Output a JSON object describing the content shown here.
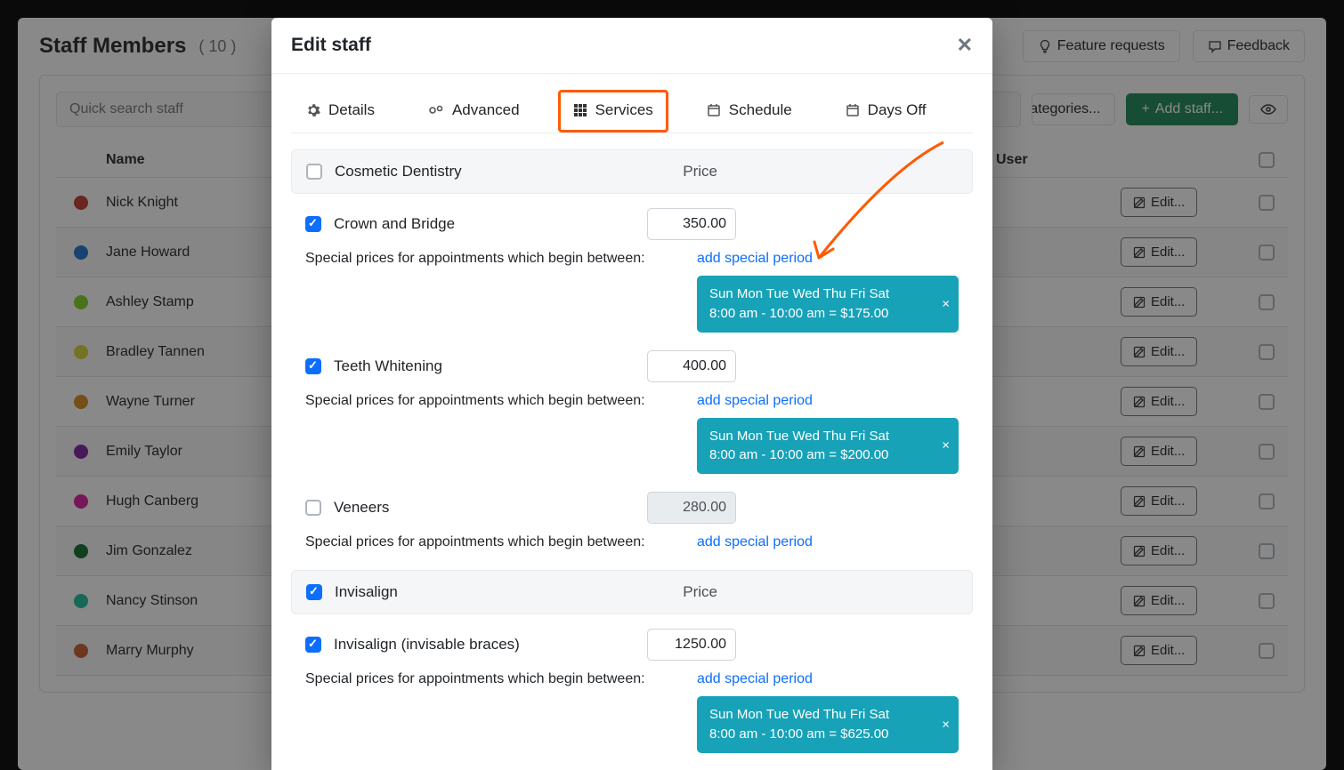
{
  "page": {
    "title": "Staff Members",
    "count": "( 10 )",
    "search_placeholder": "Quick search staff",
    "feature_button": "Feature requests",
    "feedback_button": "Feedback",
    "categories_button": "Categories...",
    "add_staff_button": "Add staff...",
    "col_name": "Name",
    "col_user": "User",
    "edit_label": "Edit..."
  },
  "staff": [
    {
      "name": "Nick Knight",
      "color": "#c0392b"
    },
    {
      "name": "Jane Howard",
      "color": "#1e70cd"
    },
    {
      "name": "Ashley Stamp",
      "color": "#7ed321"
    },
    {
      "name": "Bradley Tannen",
      "color": "#d6d034"
    },
    {
      "name": "Wayne Turner",
      "color": "#d68a1f"
    },
    {
      "name": "Emily Taylor",
      "color": "#7b1fa2"
    },
    {
      "name": "Hugh Canberg",
      "color": "#d81b9a"
    },
    {
      "name": "Jim Gonzalez",
      "color": "#116b29"
    },
    {
      "name": "Nancy Stinson",
      "color": "#1abc9c"
    },
    {
      "name": "Marry Murphy",
      "color": "#c75b2c"
    }
  ],
  "modal": {
    "title": "Edit staff",
    "tabs": {
      "details": "Details",
      "advanced": "Advanced",
      "services": "Services",
      "schedule": "Schedule",
      "daysoff": "Days Off"
    },
    "special_label": "Special prices for appointments which begin between:",
    "add_period": "add special period",
    "price_header": "Price",
    "categories": [
      {
        "name": "Cosmetic Dentistry",
        "checked": false,
        "services": [
          {
            "name": "Crown and Bridge",
            "checked": true,
            "price": "350.00",
            "period": {
              "days": "Sun Mon Tue Wed Thu Fri Sat",
              "time": "8:00 am - 10:00 am = $175.00"
            }
          },
          {
            "name": "Teeth Whitening",
            "checked": true,
            "price": "400.00",
            "period": {
              "days": "Sun Mon Tue Wed Thu Fri Sat",
              "time": "8:00 am - 10:00 am = $200.00"
            }
          },
          {
            "name": "Veneers",
            "checked": false,
            "price": "280.00",
            "period": null
          }
        ]
      },
      {
        "name": "Invisalign",
        "checked": true,
        "services": [
          {
            "name": "Invisalign (invisable braces)",
            "checked": true,
            "price": "1250.00",
            "period": {
              "days": "Sun Mon Tue Wed Thu Fri Sat",
              "time": "8:00 am - 10:00 am = $625.00"
            }
          }
        ]
      }
    ]
  }
}
